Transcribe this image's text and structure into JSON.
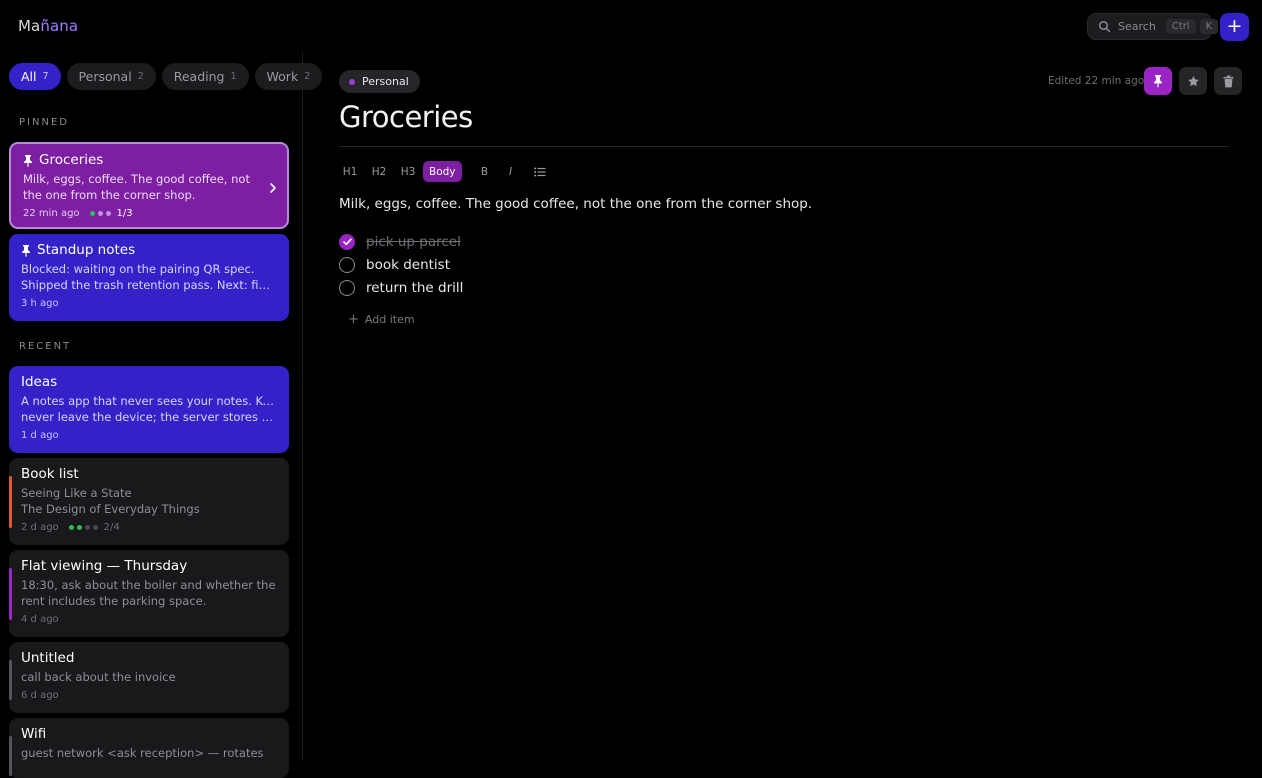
{
  "app": {
    "name_prefix": "Ma",
    "name_accent": "ñ",
    "name_suffix": "ana"
  },
  "search": {
    "placeholder": "Search",
    "shortcut_mod": "Ctrl",
    "shortcut_key": "K"
  },
  "add_button": {
    "label": "+"
  },
  "tabs": [
    {
      "label": "All",
      "count": "7"
    },
    {
      "label": "Personal",
      "count": "2"
    },
    {
      "label": "Reading",
      "count": "1"
    },
    {
      "label": "Work",
      "count": "2"
    }
  ],
  "sections": {
    "pinned": "PINNED",
    "recent": "RECENT"
  },
  "pinned": [
    {
      "title": "Groceries",
      "snippet": "Milk, eggs, coffee. The good coffee, not the one from the corner shop.",
      "time": "22 min ago",
      "progress": "1/3"
    },
    {
      "title": "Standup notes",
      "snippet_1": "Blocked: waiting on the pairing QR spec.",
      "snippet_2": "Shipped the trash retention pass. Next: field-level",
      "time": "3 h ago"
    }
  ],
  "recent": [
    {
      "title": "Ideas",
      "snippet_1": "A notes app that never sees your notes. Keys",
      "snippet_2": "never leave the device; the server stores ciphertext",
      "time": "1 d ago"
    },
    {
      "title": "Book list",
      "snippet_1": "Seeing Like a State",
      "snippet_2": "The Design of Everyday Things",
      "time": "2 d ago",
      "progress": "2/4",
      "stripe_color": "#e0582e"
    },
    {
      "title": "Flat viewing — Thursday",
      "snippet": "18:30, ask about the boiler and whether the rent includes the parking space.",
      "time": "4 d ago",
      "stripe_color": "#9a24c4"
    },
    {
      "title": "Untitled",
      "snippet": "call back about the invoice",
      "time": "6 d ago",
      "stripe_color": "#55555b"
    },
    {
      "title": "Wifi",
      "snippet": "guest network <ask reception> — rotates",
      "stripe_color": "#55555b"
    }
  ],
  "editor": {
    "tag": "Personal",
    "edited": "Edited 22 min ago",
    "title": "Groceries",
    "toolbar": {
      "h1": "H1",
      "h2": "H2",
      "h3": "H3",
      "body": "Body",
      "bold": "B",
      "italic": "I"
    },
    "body": "Milk, eggs, coffee. The good coffee, not the one from the corner shop.",
    "checklist": [
      {
        "label": "pick up parcel",
        "done": true
      },
      {
        "label": "book dentist",
        "done": false
      },
      {
        "label": "return the drill",
        "done": false
      }
    ],
    "add_item": "Add item"
  },
  "colors": {
    "accent_blue": "#3422c9",
    "accent_purple": "#7d1ea3",
    "done_green": "#2dbd55"
  }
}
